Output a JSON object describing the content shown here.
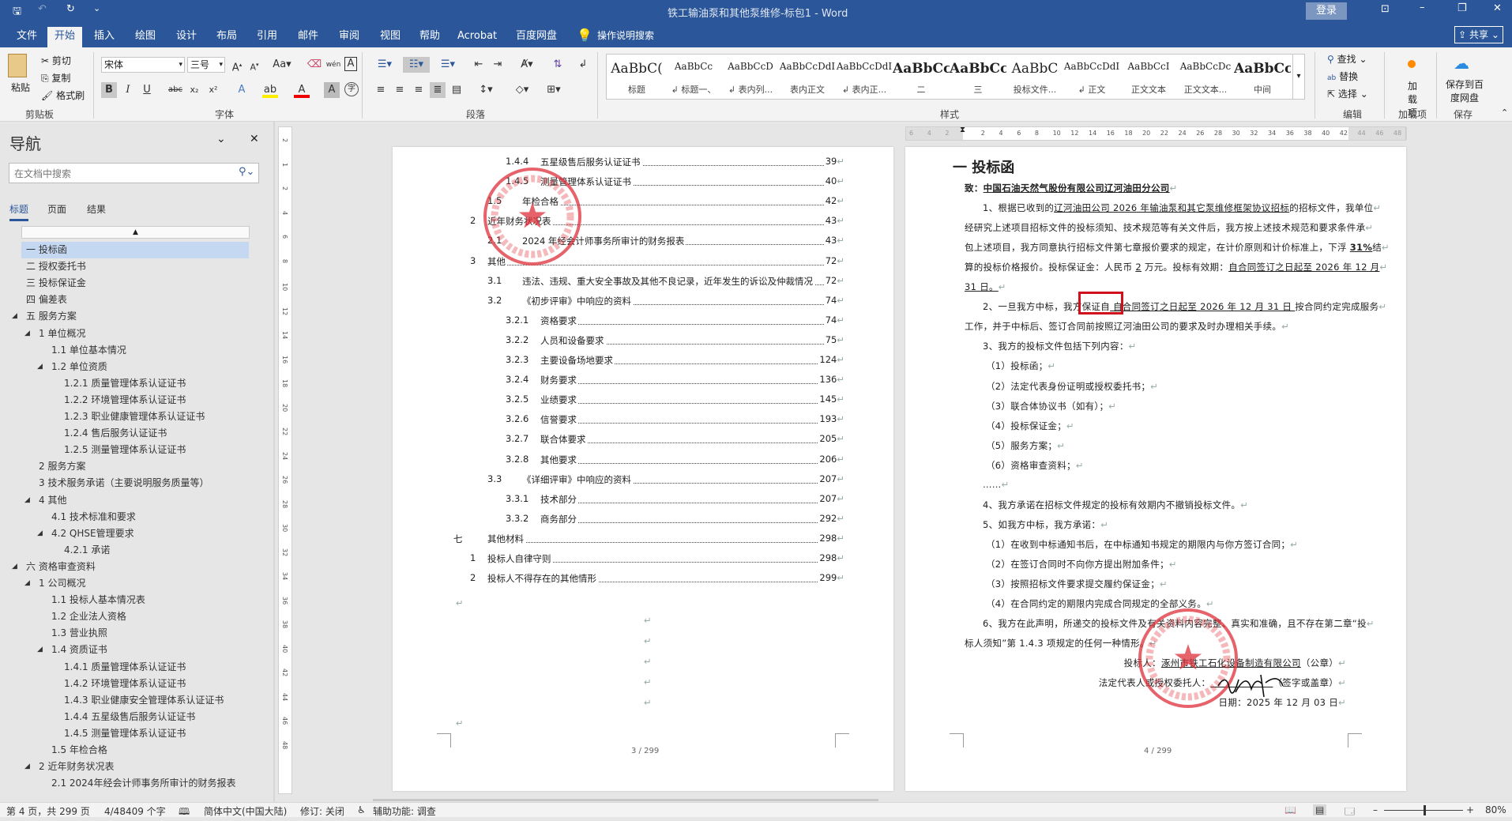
{
  "titlebar": {
    "title": "铁工输油泵和其他泵维修-标包1  -  Word",
    "login": "登录",
    "qat_more": "⌄"
  },
  "tabs": [
    {
      "label": "文件"
    },
    {
      "label": "开始",
      "active": true
    },
    {
      "label": "插入"
    },
    {
      "label": "绘图"
    },
    {
      "label": "设计"
    },
    {
      "label": "布局"
    },
    {
      "label": "引用"
    },
    {
      "label": "邮件"
    },
    {
      "label": "审阅"
    },
    {
      "label": "视图"
    },
    {
      "label": "帮助"
    },
    {
      "label": "Acrobat"
    },
    {
      "label": "百度网盘"
    }
  ],
  "tell_me": "操作说明搜索",
  "share": "共享",
  "ribbon": {
    "clipboard": {
      "group": "剪贴板",
      "paste": "粘贴",
      "cut": "剪切",
      "copy": "复制",
      "format_painter": "格式刷"
    },
    "font": {
      "group": "字体",
      "name": "宋体",
      "size": "三号"
    },
    "paragraph": {
      "group": "段落"
    },
    "styles": {
      "group": "样式",
      "items": [
        {
          "preview": "AaBbC(",
          "name": "标题"
        },
        {
          "preview": "AaBbCc",
          "name": "↲ 标题一、"
        },
        {
          "preview": "AaBbCcD",
          "name": "↲ 表内列..."
        },
        {
          "preview": "AaBbCcDdI",
          "name": "表内正文"
        },
        {
          "preview": "AaBbCcDdI",
          "name": "↲ 表内正..."
        },
        {
          "preview": "AaBbCc",
          "name": "二"
        },
        {
          "preview": "AaBbCc",
          "name": "三"
        },
        {
          "preview": "AaBbC",
          "name": "投标文件..."
        },
        {
          "preview": "AaBbCcDdI",
          "name": "↲ 正文"
        },
        {
          "preview": "AaBbCcI",
          "name": "正文文本"
        },
        {
          "preview": "AaBbCcDc",
          "name": "正文文本..."
        },
        {
          "preview": "AaBbCc",
          "name": "中间"
        }
      ]
    },
    "editing": {
      "group": "编辑",
      "find": "查找",
      "replace": "替换",
      "select": "选择"
    },
    "addins": {
      "group": "加载项",
      "label": "加载项"
    },
    "save": {
      "group": "保存",
      "label": "保存到百度网盘"
    }
  },
  "nav": {
    "title": "导航",
    "search_placeholder": "在文档中搜索",
    "tabs": [
      "标题",
      "页面",
      "结果"
    ],
    "items": [
      {
        "label": "一 投标函",
        "level": 0,
        "selected": true
      },
      {
        "label": "二 授权委托书",
        "level": 0
      },
      {
        "label": "三 投标保证金",
        "level": 0
      },
      {
        "label": "四 偏差表",
        "level": 0
      },
      {
        "label": "五 服务方案",
        "level": 0,
        "expanded": true
      },
      {
        "label": "1 单位概况",
        "level": 1,
        "expanded": true
      },
      {
        "label": "1.1 单位基本情况",
        "level": 2
      },
      {
        "label": "1.2 单位资质",
        "level": 2,
        "expanded": true
      },
      {
        "label": "1.2.1 质量管理体系认证证书",
        "level": 3
      },
      {
        "label": "1.2.2 环境管理体系认证证书",
        "level": 3
      },
      {
        "label": "1.2.3 职业健康管理体系认证证书",
        "level": 3
      },
      {
        "label": "1.2.4 售后服务认证证书",
        "level": 3
      },
      {
        "label": "1.2.5 测量管理体系认证证书",
        "level": 3
      },
      {
        "label": "2 服务方案",
        "level": 1
      },
      {
        "label": "3 技术服务承诺（主要说明服务质量等）",
        "level": 1
      },
      {
        "label": "4 其他",
        "level": 1,
        "expanded": true
      },
      {
        "label": "4.1 技术标准和要求",
        "level": 2
      },
      {
        "label": "4.2 QHSE管理要求",
        "level": 2,
        "expanded": true
      },
      {
        "label": "4.2.1 承诺",
        "level": 3
      },
      {
        "label": "六 资格审查资料",
        "level": 0,
        "expanded": true
      },
      {
        "label": "1 公司概况",
        "level": 1,
        "expanded": true
      },
      {
        "label": "1.1 投标人基本情况表",
        "level": 2
      },
      {
        "label": "1.2 企业法人资格",
        "level": 2
      },
      {
        "label": "1.3 营业执照",
        "level": 2
      },
      {
        "label": "1.4 资质证书",
        "level": 2,
        "expanded": true
      },
      {
        "label": "1.4.1 质量管理体系认证证书",
        "level": 3
      },
      {
        "label": "1.4.2 环境管理体系认证证书",
        "level": 3
      },
      {
        "label": "1.4.3 职业健康安全管理体系认证证书",
        "level": 3
      },
      {
        "label": "1.4.4 五星级售后服务认证证书",
        "level": 3
      },
      {
        "label": "1.4.5 测量管理体系认证证书",
        "level": 3
      },
      {
        "label": "1.5 年检合格",
        "level": 2
      },
      {
        "label": "2 近年财务状况表",
        "level": 1,
        "expanded": true
      },
      {
        "label": "2.1 2024年经会计师事务所审计的财务报表",
        "level": 2
      }
    ]
  },
  "page3": {
    "toc": [
      {
        "num": "1.4.4",
        "text": "五星级售后服务认证证书",
        "page": "39",
        "level": 3
      },
      {
        "num": "1.4.5",
        "text": "测量管理体系认证证书",
        "page": "40",
        "level": 3
      },
      {
        "num": "1.5",
        "text": "年检合格",
        "page": "42",
        "level": 2
      },
      {
        "num": "2",
        "text": "近年财务状况表",
        "page": "43",
        "level": 1
      },
      {
        "num": "2.1",
        "text": "2024 年经会计师事务所审计的财务报表",
        "page": "43",
        "level": 2
      },
      {
        "num": "3",
        "text": "其他",
        "page": "72",
        "level": 1
      },
      {
        "num": "3.1",
        "text": "违法、违规、重大安全事故及其他不良记录，近年发生的诉讼及仲裁情况",
        "page": "72",
        "level": 2
      },
      {
        "num": "3.2",
        "text": "《初步评审》中响应的资料",
        "page": "74",
        "level": 2
      },
      {
        "num": "3.2.1",
        "text": "资格要求",
        "page": "74",
        "level": 3
      },
      {
        "num": "3.2.2",
        "text": "人员和设备要求",
        "page": "75",
        "level": 3
      },
      {
        "num": "3.2.3",
        "text": "主要设备场地要求",
        "page": "124",
        "level": 3
      },
      {
        "num": "3.2.4",
        "text": "财务要求",
        "page": "136",
        "level": 3
      },
      {
        "num": "3.2.5",
        "text": "业绩要求",
        "page": "145",
        "level": 3
      },
      {
        "num": "3.2.6",
        "text": "信誉要求",
        "page": "193",
        "level": 3
      },
      {
        "num": "3.2.7",
        "text": "联合体要求",
        "page": "205",
        "level": 3
      },
      {
        "num": "3.2.8",
        "text": "其他要求",
        "page": "206",
        "level": 3
      },
      {
        "num": "3.3",
        "text": "《详细评审》中响应的资料",
        "page": "207",
        "level": 2
      },
      {
        "num": "3.3.1",
        "text": "技术部分",
        "page": "207",
        "level": 3
      },
      {
        "num": "3.3.2",
        "text": "商务部分",
        "page": "292",
        "level": 3
      },
      {
        "num": "七",
        "text": "其他材料",
        "page": "298",
        "level": 0
      },
      {
        "num": "1",
        "text": "投标人自律守则",
        "page": "298",
        "level": 1
      },
      {
        "num": "2",
        "text": "投标人不得存在的其他情形",
        "page": "299",
        "level": 1
      }
    ],
    "footer": "3 / 299"
  },
  "page4": {
    "heading": "一 投标函",
    "lines": [
      {
        "segs": [
          {
            "t": "致：",
            "b": 1
          },
          {
            "t": "中国石油天然气股份有限公司辽河油田分公司",
            "b": 1,
            "u": 1
          }
        ]
      },
      {
        "ind": 1,
        "segs": [
          {
            "t": "1、根据已收到的"
          },
          {
            "t": "辽河油田公司 2026 年输油泵和其它泵维修框架协议招标",
            "u": 1
          },
          {
            "t": "的招标文件，我单位"
          }
        ]
      },
      {
        "segs": [
          {
            "t": "经研究上述项目招标文件的投标须知、技术规范等有关文件后，我方按上述技术规范和要求条件承"
          }
        ]
      },
      {
        "segs": [
          {
            "t": "包上述项目，我方同意执行招标文件第七章报价要求的规定，在计价原则和计价标准上，下浮 "
          },
          {
            "t": "31%",
            "b": 1,
            "u": 1
          },
          {
            "t": "结"
          }
        ]
      },
      {
        "segs": [
          {
            "t": "算的投标价格报价。投标保证金：人民币 "
          },
          {
            "t": "2",
            "u": 1
          },
          {
            "t": " 万元。投标有效期："
          },
          {
            "t": "自合同签订之日起至 2026 年 12 月",
            "u": 1
          }
        ]
      },
      {
        "segs": [
          {
            "t": "31 日。",
            "u": 1
          }
        ]
      },
      {
        "ind": 1,
        "segs": [
          {
            "t": "2、一旦我方中标，我方保证自"
          },
          {
            "t": " 自合同签订之日起至 2026 年 12 月 31 日 ",
            "u": 1
          },
          {
            "t": "按合同约定完成服务"
          }
        ]
      },
      {
        "segs": [
          {
            "t": "工作，并于中标后、签订合同前按照辽河油田公司的要求及时办理相关手续。"
          }
        ]
      },
      {
        "ind": 1,
        "segs": [
          {
            "t": "3、我方的投标文件包括下列内容："
          }
        ]
      },
      {
        "ind": 2,
        "segs": [
          {
            "t": "（1）投标函；"
          }
        ]
      },
      {
        "ind": 2,
        "segs": [
          {
            "t": "（2）法定代表身份证明或授权委托书；"
          }
        ]
      },
      {
        "ind": 2,
        "segs": [
          {
            "t": "（3）联合体协议书（如有）；"
          }
        ]
      },
      {
        "ind": 2,
        "segs": [
          {
            "t": "（4）投标保证金；"
          }
        ]
      },
      {
        "ind": 2,
        "segs": [
          {
            "t": "（5）服务方案；"
          }
        ]
      },
      {
        "ind": 2,
        "segs": [
          {
            "t": "（6）资格审查资料；"
          }
        ]
      },
      {
        "ind": 1,
        "segs": [
          {
            "t": "……"
          }
        ]
      },
      {
        "ind": 1,
        "segs": [
          {
            "t": "4、我方承诺在招标文件规定的投标有效期内不撤销投标文件。"
          }
        ]
      },
      {
        "ind": 1,
        "segs": [
          {
            "t": "5、如我方中标，我方承诺："
          }
        ]
      },
      {
        "ind": 2,
        "segs": [
          {
            "t": "（1）在收到中标通知书后，在中标通知书规定的期限内与你方签订合同；"
          }
        ]
      },
      {
        "ind": 2,
        "segs": [
          {
            "t": "（2）在签订合同时不向你方提出附加条件；"
          }
        ]
      },
      {
        "ind": 2,
        "segs": [
          {
            "t": "（3）按照招标文件要求提交履约保证金；"
          }
        ]
      },
      {
        "ind": 2,
        "segs": [
          {
            "t": "（4）在合同约定的期限内完成合同规定的全部义务。"
          }
        ]
      },
      {
        "ind": 1,
        "segs": [
          {
            "t": "6、我方在此声明，所递交的投标文件及有关资料内容完整、真实和准确，且不存在第二章“投"
          }
        ]
      },
      {
        "segs": [
          {
            "t": "标人须知”第 1.4.3 项规定的任何一种情形。"
          }
        ]
      },
      {
        "right": 1,
        "segs": [
          {
            "t": "投标人："
          },
          {
            "t": "涿州市铁工石化设备制造有限公司",
            "u": 1
          },
          {
            "t": "（公章）"
          }
        ]
      },
      {
        "right": 1,
        "segs": [
          {
            "t": "法定代表人或授权委托人："
          },
          {
            "t": "                    ",
            "u": 1
          },
          {
            "t": "（签字或盖章）"
          }
        ]
      },
      {
        "right": 1,
        "segs": [
          {
            "t": "日期：2025 年 12 月 03 日"
          }
        ]
      }
    ],
    "footer": "4 / 299"
  },
  "ruler": {
    "h": [
      "6",
      "4",
      "2",
      "",
      "2",
      "4",
      "6",
      "8",
      "10",
      "12",
      "14",
      "16",
      "18",
      "20",
      "22",
      "24",
      "26",
      "28",
      "30",
      "32",
      "34",
      "36",
      "38",
      "40",
      "42",
      "44",
      "46",
      "48"
    ],
    "v": [
      "2",
      "1",
      "2",
      "4",
      "6",
      "8",
      "10",
      "12",
      "14",
      "16",
      "18",
      "20",
      "22",
      "24",
      "26",
      "28",
      "30",
      "32",
      "34",
      "36",
      "38",
      "40",
      "42",
      "44",
      "46",
      "48"
    ]
  },
  "status": {
    "page": "第 4 页，共 299 页",
    "words": "4/48409 个字",
    "language": "简体中文(中国大陆)",
    "track": "修订: 关闭",
    "accessibility": "辅助功能: 调查",
    "zoom": "80%",
    "zoom_percent": 80
  },
  "colors": {
    "brand": "#2b579a",
    "stamp": "#e0303a",
    "highlight_box": "#d0101c"
  }
}
